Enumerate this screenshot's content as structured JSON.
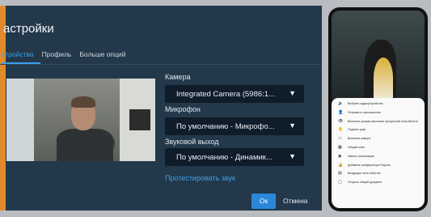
{
  "dialog": {
    "title": "астройки",
    "tabs": [
      {
        "label": "стройства",
        "active": true
      },
      {
        "label": "Профиль",
        "active": false
      },
      {
        "label": "Больше опций",
        "active": false
      }
    ],
    "camera": {
      "label": "Камера",
      "value": "Integrated Camera (5986:1..."
    },
    "microphone": {
      "label": "Микрофон",
      "value": "По умолчанию - Микрофо..."
    },
    "speaker": {
      "label": "Звуковой выход",
      "value": "По умолчанию - Динамик..."
    },
    "test_link": "Протестировать звук",
    "ok_label": "Ок",
    "cancel_label": "Отмена",
    "accent_color": "#3da0e8",
    "sidebar_accent": "#e08a2c"
  },
  "phone": {
    "menu": [
      {
        "icon": "speaker-icon",
        "glyph": "🔈",
        "label": "Выбрать аудиоустройство"
      },
      {
        "icon": "add-user-icon",
        "glyph": "👤",
        "label": "Отправить приглашение"
      },
      {
        "icon": "eye-icon",
        "glyph": "👁",
        "label": "Включить режим экономии пропускной способности"
      },
      {
        "icon": "hand-icon",
        "glyph": "✋",
        "label": "Поднять руку"
      },
      {
        "icon": "camera-icon",
        "glyph": "▭",
        "label": "Внешняя камера"
      },
      {
        "icon": "tile-icon",
        "glyph": "▦",
        "label": "Общий план"
      },
      {
        "icon": "record-icon",
        "glyph": "◉",
        "label": "Начать трансляцию"
      },
      {
        "icon": "lock-icon",
        "glyph": "🔒",
        "label": "Добавить конференции Пароль"
      },
      {
        "icon": "chat-icon",
        "glyph": "▤",
        "label": "Входящие окно событие"
      },
      {
        "icon": "document-icon",
        "glyph": "▢",
        "label": "Открыть общий документ"
      }
    ]
  }
}
